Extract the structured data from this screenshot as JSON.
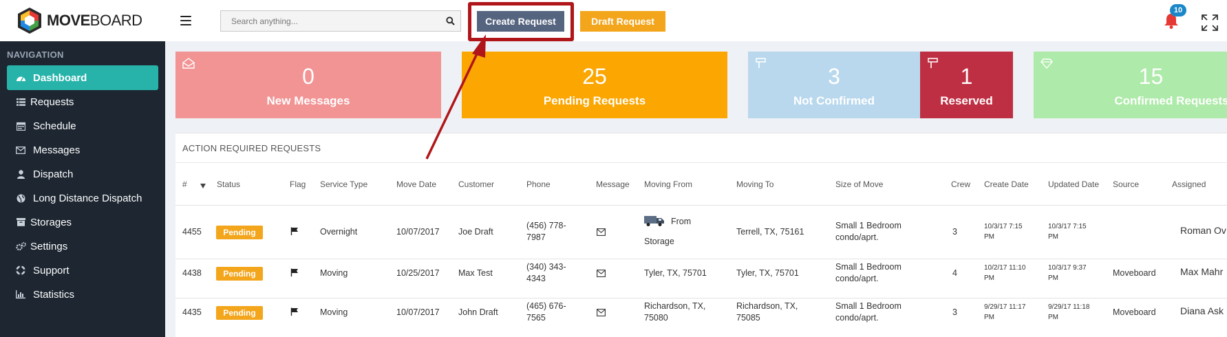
{
  "app": {
    "logo_bold": "MOVE",
    "logo_light": "BOARD",
    "logo_tail": ""
  },
  "header": {
    "search_placeholder": "Search anything...",
    "create_request_label": "Create Request",
    "draft_request_label": "Draft Request",
    "notification_count": "10"
  },
  "sidebar": {
    "heading": "NAVIGATION",
    "items": [
      {
        "label": "Dashboard",
        "icon": "dashboard-icon"
      },
      {
        "label": "Requests",
        "icon": "list-icon"
      },
      {
        "label": "Schedule",
        "icon": "calendar-icon"
      },
      {
        "label": "Messages",
        "icon": "envelope-icon"
      },
      {
        "label": "Dispatch",
        "icon": "user-icon"
      },
      {
        "label": "Long Distance Dispatch",
        "icon": "globe-icon"
      },
      {
        "label": "Storages",
        "icon": "archive-icon"
      },
      {
        "label": "Settings",
        "icon": "gears-icon"
      },
      {
        "label": "Support",
        "icon": "lifebuoy-icon"
      },
      {
        "label": "Statistics",
        "icon": "bar-chart-icon"
      }
    ]
  },
  "tiles": [
    {
      "value": "0",
      "label": "New Messages",
      "color": "#f29394",
      "icon": "envelope-open-icon"
    },
    {
      "value": "25",
      "label": "Pending Requests",
      "color": "#fba601"
    },
    {
      "value": "3",
      "label": "Not Confirmed",
      "color": "#b9d8ed",
      "icon": "signpost-icon"
    },
    {
      "value": "1",
      "label": "Reserved",
      "color": "#bf2f43",
      "icon": "signpost-icon"
    },
    {
      "value": "15",
      "label": "Confirmed Requests",
      "color": "#aeeaa9",
      "icon": "diamond-icon"
    }
  ],
  "table": {
    "title": "ACTION REQUIRED REQUESTS",
    "headers": {
      "num": "#",
      "status": "Status",
      "flag": "Flag",
      "service_type": "Service Type",
      "move_date": "Move Date",
      "customer": "Customer",
      "phone": "Phone",
      "message": "Message",
      "moving_from": "Moving From",
      "moving_to": "Moving To",
      "size_of_move": "Size of Move",
      "crew": "Crew",
      "create_date": "Create Date",
      "updated_date": "Updated Date",
      "source": "Source",
      "assigned": "Assigned"
    },
    "rows": [
      {
        "num": "4455",
        "status": "Pending",
        "service_type": "Overnight",
        "move_date": "10/07/2017",
        "customer": "Joe Draft",
        "phone_1": "(456) 778-",
        "phone_2": "7987",
        "from_1": "From",
        "from_2": "Storage",
        "to_1": "Terrell, TX, 75161",
        "to_2": "",
        "size_1": "Small 1 Bedroom",
        "size_2": "condo/aprt.",
        "crew": "3",
        "create_1": "10/3/17 7:15",
        "create_2": "PM",
        "updated_1": "10/3/17 7:15",
        "updated_2": "PM",
        "source": "",
        "assigned": "Roman Ov"
      },
      {
        "num": "4438",
        "status": "Pending",
        "service_type": "Moving",
        "move_date": "10/25/2017",
        "customer": "Max Test",
        "phone_1": "(340) 343-",
        "phone_2": "4343",
        "from_1": "Tyler, TX, 75701",
        "from_2": "",
        "to_1": "Tyler, TX, 75701",
        "to_2": "",
        "size_1": "Small 1 Bedroom",
        "size_2": "condo/aprt.",
        "crew": "4",
        "create_1": "10/2/17 11:10",
        "create_2": "PM",
        "updated_1": "10/3/17 9:37",
        "updated_2": "PM",
        "source": "Moveboard",
        "assigned": "Max Mahr"
      },
      {
        "num": "4435",
        "status": "Pending",
        "service_type": "Moving",
        "move_date": "10/07/2017",
        "customer": "John Draft",
        "phone_1": "(465) 676-",
        "phone_2": "7565",
        "from_1": "Richardson, TX,",
        "from_2": "75080",
        "to_1": "Richardson, TX,",
        "to_2": "75085",
        "size_1": "Small 1 Bedroom",
        "size_2": "condo/aprt.",
        "crew": "3",
        "create_1": "9/29/17 11:17",
        "create_2": "PM",
        "updated_1": "9/29/17 11:18",
        "updated_2": "PM",
        "source": "Moveboard",
        "assigned": "Diana Ask"
      }
    ]
  },
  "colors": {
    "sidebar_bg": "#1d2631",
    "sidebar_active": "#27b3aa",
    "create_button": "#55647f",
    "draft_button": "#f3a51b",
    "highlight": "#b01619",
    "pending_badge": "#f3a51b",
    "notification_badge": "#1b87c9"
  }
}
